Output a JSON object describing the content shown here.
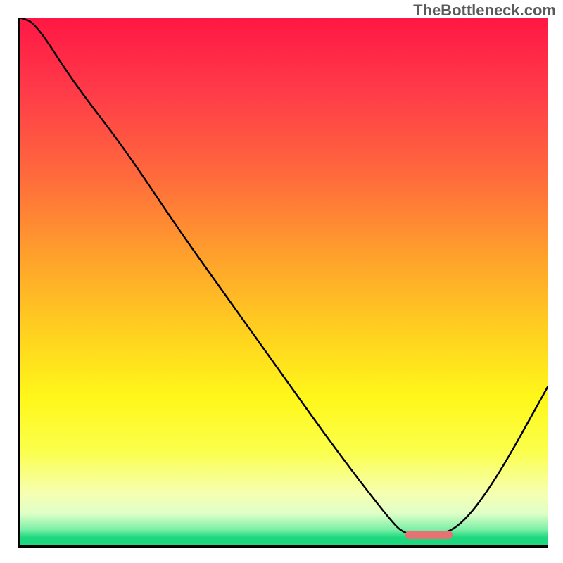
{
  "watermark": "TheBottleneck.com",
  "chart_data": {
    "type": "line",
    "title": "",
    "xlabel": "",
    "ylabel": "",
    "xlim": [
      0,
      1
    ],
    "ylim": [
      0,
      1
    ],
    "x": [
      0.0,
      0.03,
      0.1,
      0.2,
      0.3,
      0.4,
      0.5,
      0.6,
      0.7,
      0.73,
      0.78,
      0.83,
      0.9,
      1.0
    ],
    "values": [
      1.0,
      0.99,
      0.88,
      0.75,
      0.6,
      0.46,
      0.32,
      0.18,
      0.05,
      0.02,
      0.02,
      0.03,
      0.12,
      0.3
    ],
    "marker_range_x": [
      0.73,
      0.82
    ],
    "marker_y": 0.02,
    "gradient_note": "vertical gradient from red (top, high value) to green (bottom, low value) indicating bottleneck severity"
  }
}
